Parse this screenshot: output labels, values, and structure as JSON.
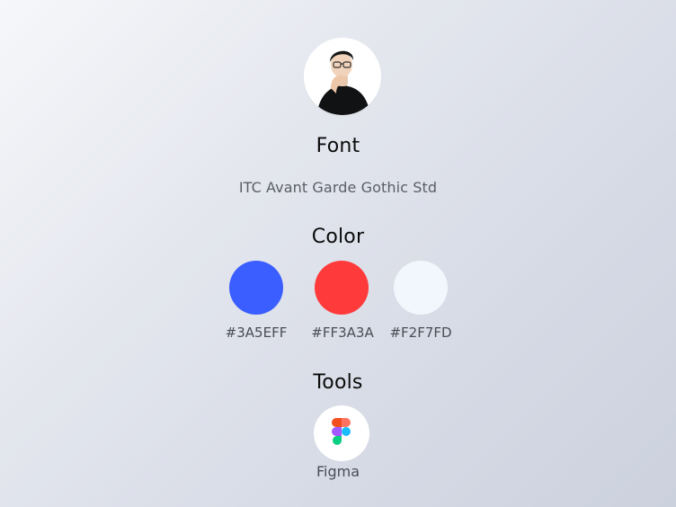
{
  "sections": {
    "font": {
      "title": "Font",
      "name": "ITC Avant Garde Gothic Std"
    },
    "color": {
      "title": "Color",
      "swatches": [
        {
          "hex": "#3A5EFF",
          "label": "#3A5EFF"
        },
        {
          "hex": "#FF3A3A",
          "label": "#FF3A3A"
        },
        {
          "hex": "#F2F7FD",
          "label": "#F2F7FD"
        }
      ]
    },
    "tools": {
      "title": "Tools",
      "items": [
        {
          "label": "Figma",
          "icon": "figma-icon"
        }
      ]
    }
  },
  "avatar": {
    "icon": "avatar-photo"
  }
}
